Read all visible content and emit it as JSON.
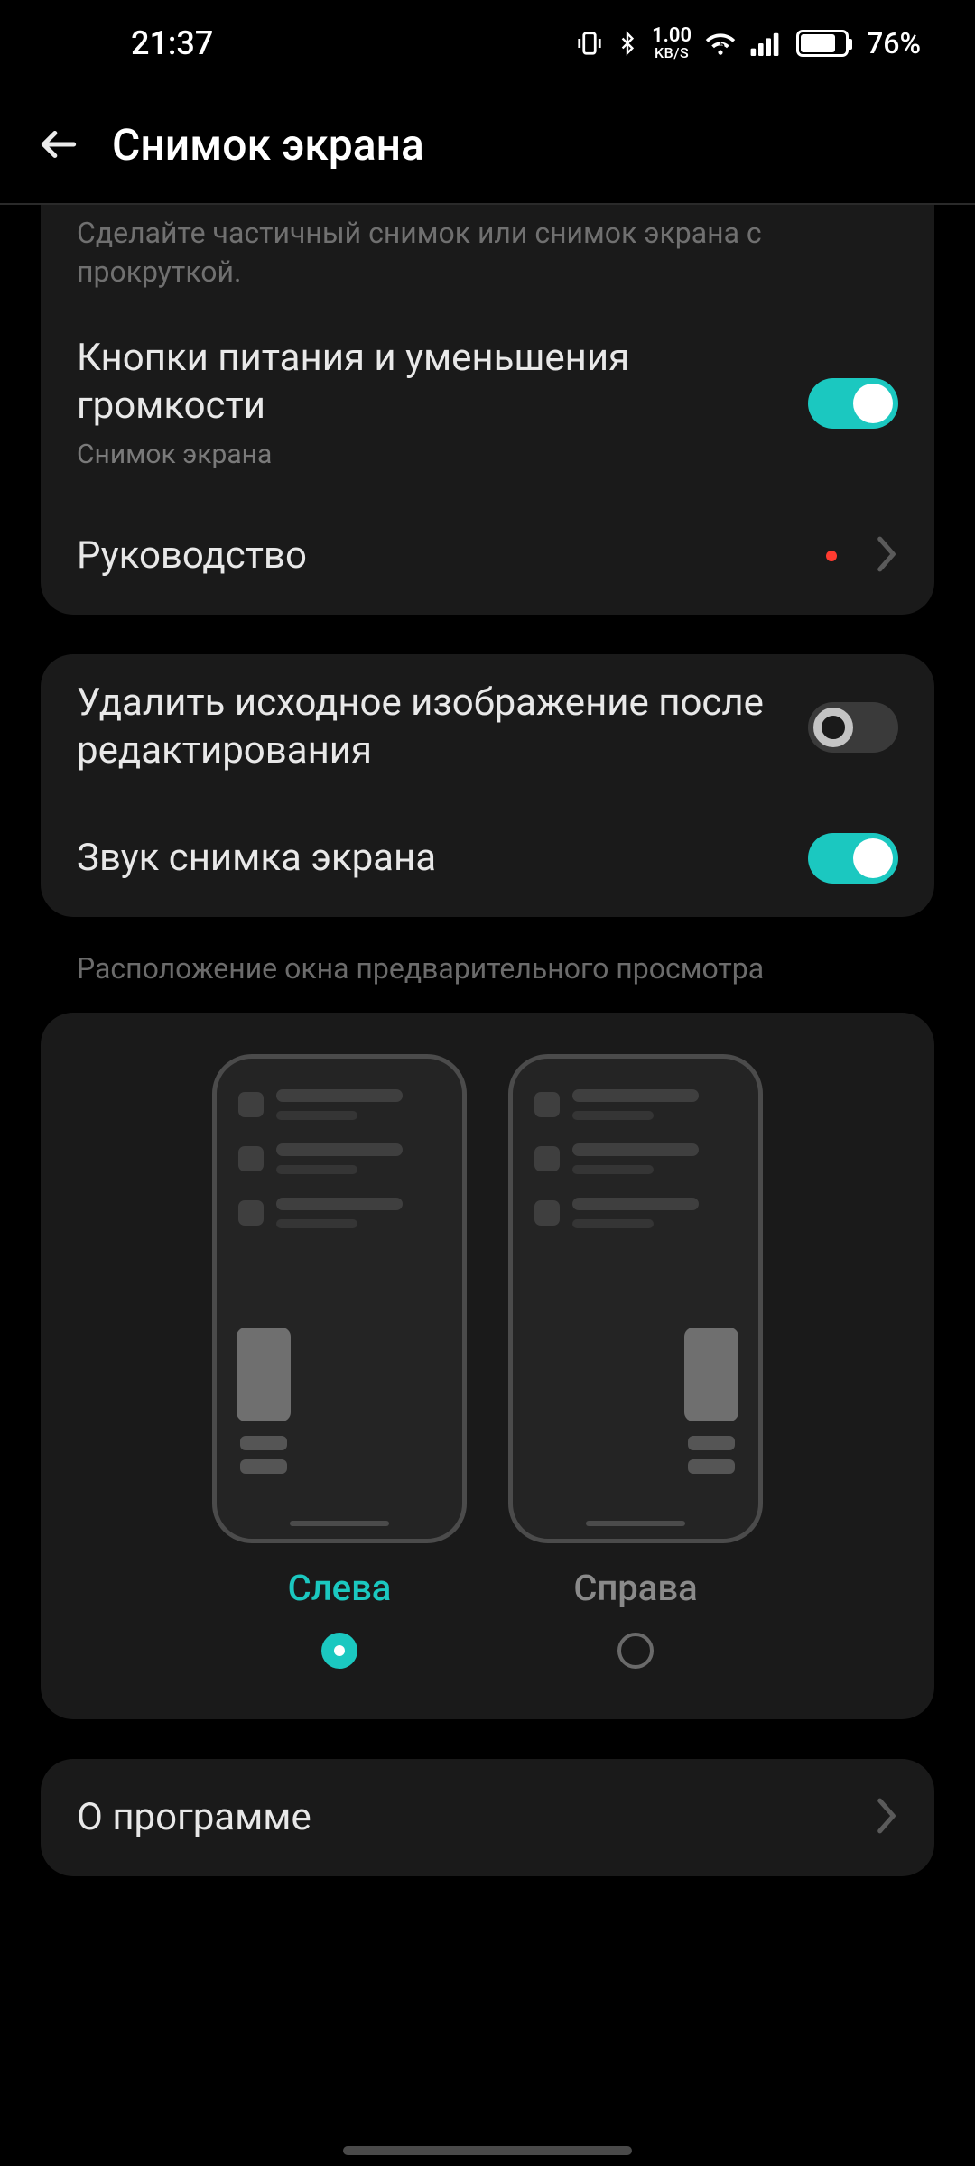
{
  "status": {
    "time": "21:37",
    "net_top": "1.00",
    "net_bot": "KB/S",
    "battery_pct": "76%",
    "battery_fill_pct": 76
  },
  "header": {
    "title": "Снимок экрана"
  },
  "card1": {
    "truncated_desc": "Сделайте частичный снимок или снимок экрана с прокруткой.",
    "power_vol": {
      "title": "Кнопки питания и уменьшения громкости",
      "sub": "Снимок экрана",
      "on": true
    },
    "guide": {
      "title": "Руководство"
    }
  },
  "card2": {
    "delete_original": {
      "title": "Удалить исходное изображение после редактирования",
      "on": false
    },
    "sound": {
      "title": "Звук снимка экрана",
      "on": true
    }
  },
  "preview": {
    "section_label": "Расположение окна предварительного просмотра",
    "left_label": "Слева",
    "right_label": "Справа",
    "selected": "left"
  },
  "card3": {
    "about": {
      "title": "О программе"
    }
  }
}
